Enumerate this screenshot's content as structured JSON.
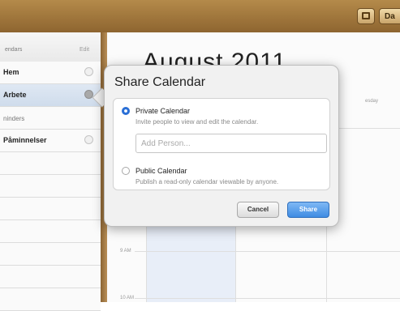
{
  "toolbar": {
    "day_label": "Da"
  },
  "sidebar": {
    "header_title": "endars",
    "edit_label": "Edit",
    "items": [
      {
        "label": "Hem"
      },
      {
        "label": "Arbete"
      },
      {
        "label": "ninders"
      },
      {
        "label": "Påminnelser"
      }
    ]
  },
  "main": {
    "month_title": "August 2011",
    "column_header": "esday",
    "time_labels": [
      "9 AM",
      "10 AM"
    ]
  },
  "share_popover": {
    "title": "Share Calendar",
    "private_option": {
      "label": "Private Calendar",
      "description": "Invite people to view and edit the calendar.",
      "selected": true
    },
    "add_person_placeholder": "Add Person...",
    "add_person_value": "",
    "public_option": {
      "label": "Public Calendar",
      "description": "Publish a read-only calendar viewable by anyone.",
      "selected": false
    },
    "cancel_label": "Cancel",
    "share_label": "Share"
  },
  "colors": {
    "accent": "#2a6fd6",
    "share_button": "#3f8ce3",
    "toolbar_wood": "#a57a3e",
    "selected_row": "#d6e1ef"
  }
}
